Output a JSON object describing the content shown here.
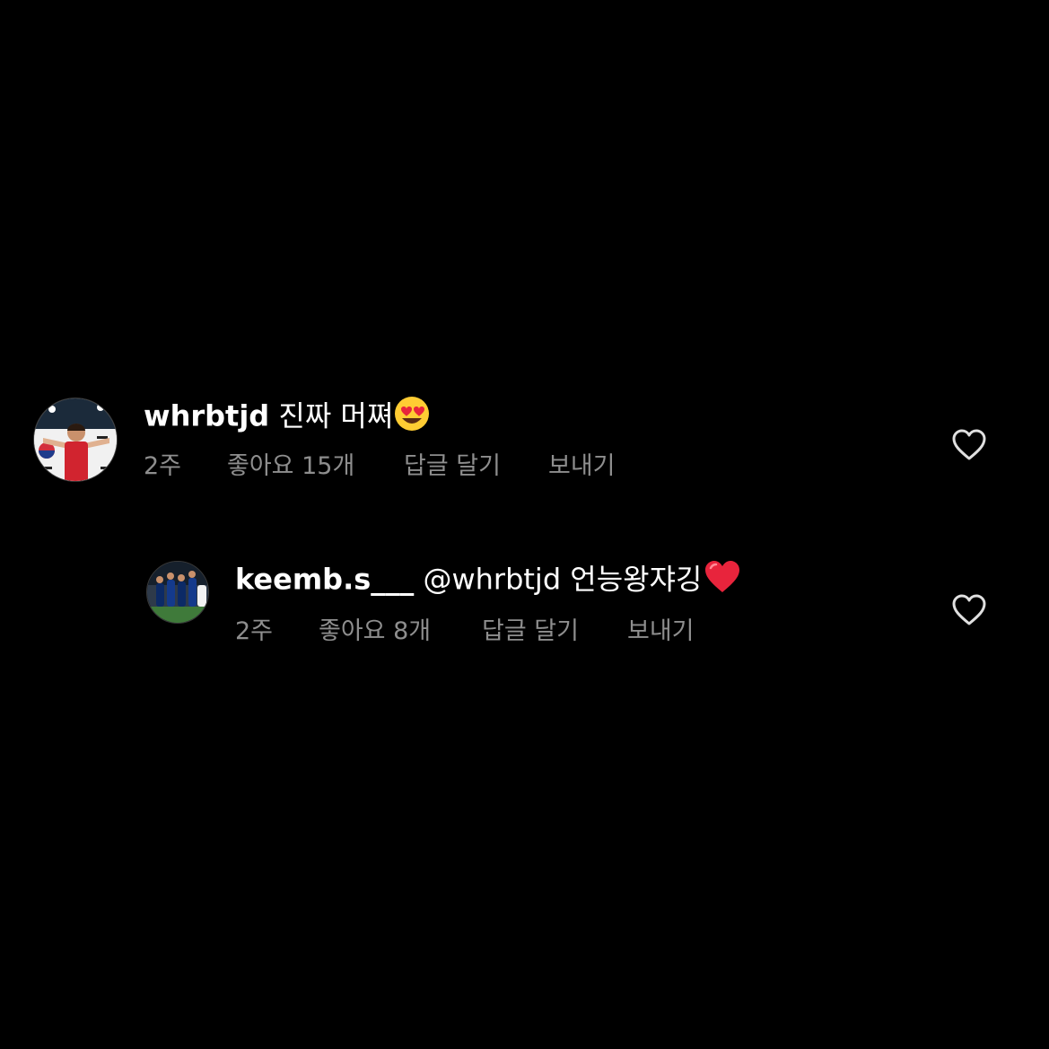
{
  "comments": [
    {
      "username": "whrbtjd",
      "text": "진짜 머쪄",
      "emoji": "smiling-face-with-heart-eyes",
      "time": "2주",
      "likes": "좋아요 15개",
      "reply": "답글 달기",
      "send": "보내기"
    },
    {
      "username": "keemb.s___",
      "mention": "@whrbtjd",
      "text": "언능왕쟈깅",
      "emoji": "red-heart",
      "time": "2주",
      "likes": "좋아요 8개",
      "reply": "답글 달기",
      "send": "보내기"
    }
  ],
  "colors": {
    "background": "#000000",
    "text": "#ffffff",
    "meta": "#8e8e8e",
    "heart_emoji": "#e8243c"
  }
}
